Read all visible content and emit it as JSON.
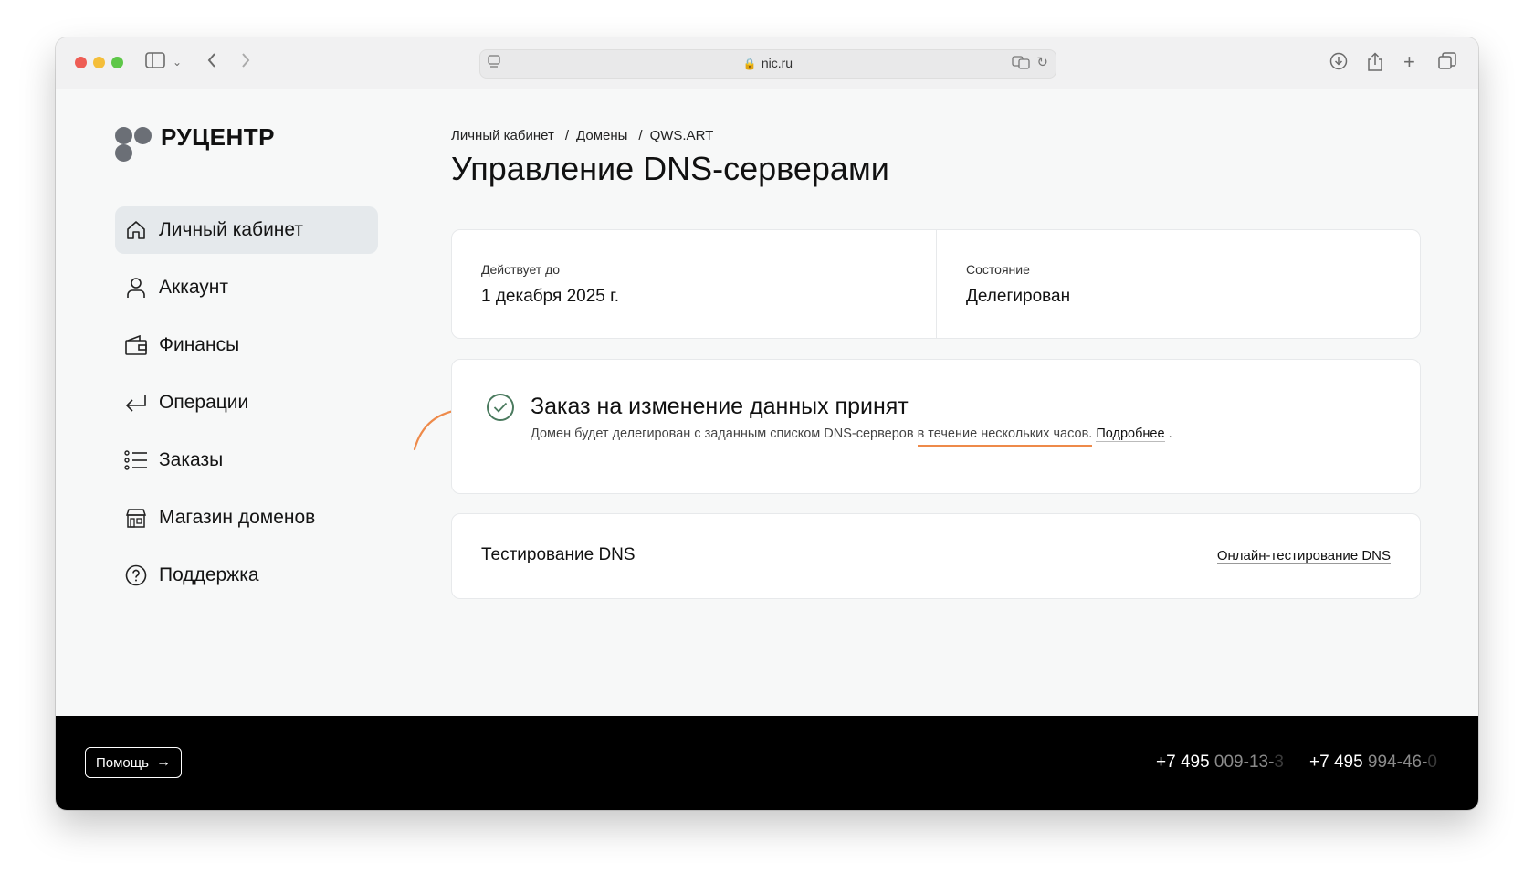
{
  "browser": {
    "url": "nic.ru"
  },
  "brand": {
    "name": "РУЦЕНТР"
  },
  "sidebar": {
    "items": [
      {
        "label": "Личный кабинет",
        "icon": "home-icon",
        "active": true
      },
      {
        "label": "Аккаунт",
        "icon": "user-icon",
        "active": false
      },
      {
        "label": "Финансы",
        "icon": "wallet-icon",
        "active": false
      },
      {
        "label": "Операции",
        "icon": "return-arrow-icon",
        "active": false
      },
      {
        "label": "Заказы",
        "icon": "list-icon",
        "active": false
      },
      {
        "label": "Магазин доменов",
        "icon": "store-icon",
        "active": false
      },
      {
        "label": "Поддержка",
        "icon": "question-icon",
        "active": false
      }
    ]
  },
  "breadcrumb": [
    "Личный кабинет",
    "Домены",
    "QWS.ART"
  ],
  "breadcrumb_separator": "/",
  "page": {
    "title": "Управление DNS-серверами"
  },
  "info": {
    "valid_until_label": "Действует до",
    "valid_until_value": "1 декабря 2025 г.",
    "status_label": "Состояние",
    "status_value": "Делегирован"
  },
  "message": {
    "title": "Заказ на изменение данных принят",
    "text_before": "Домен будет делегирован с заданным списком DNS-серверов ",
    "text_highlight": "в течение нескольких часов.",
    "link": "Подробнее",
    "text_after": " ."
  },
  "dns": {
    "title": "Тестирование DNS",
    "link": "Онлайн-тестирование DNS"
  },
  "footer": {
    "help_label": "Помощь",
    "phone1": {
      "a": "+7 495 ",
      "b": "009-13-",
      "c": "3"
    },
    "phone2": {
      "a": "+7 495 ",
      "b": "994-46-",
      "c": "0"
    }
  },
  "colors": {
    "accent_arrow": "#ee8a4a",
    "check": "#4a7a5e",
    "active_nav_bg": "#e5e9ec",
    "footer_bg": "#000000"
  }
}
